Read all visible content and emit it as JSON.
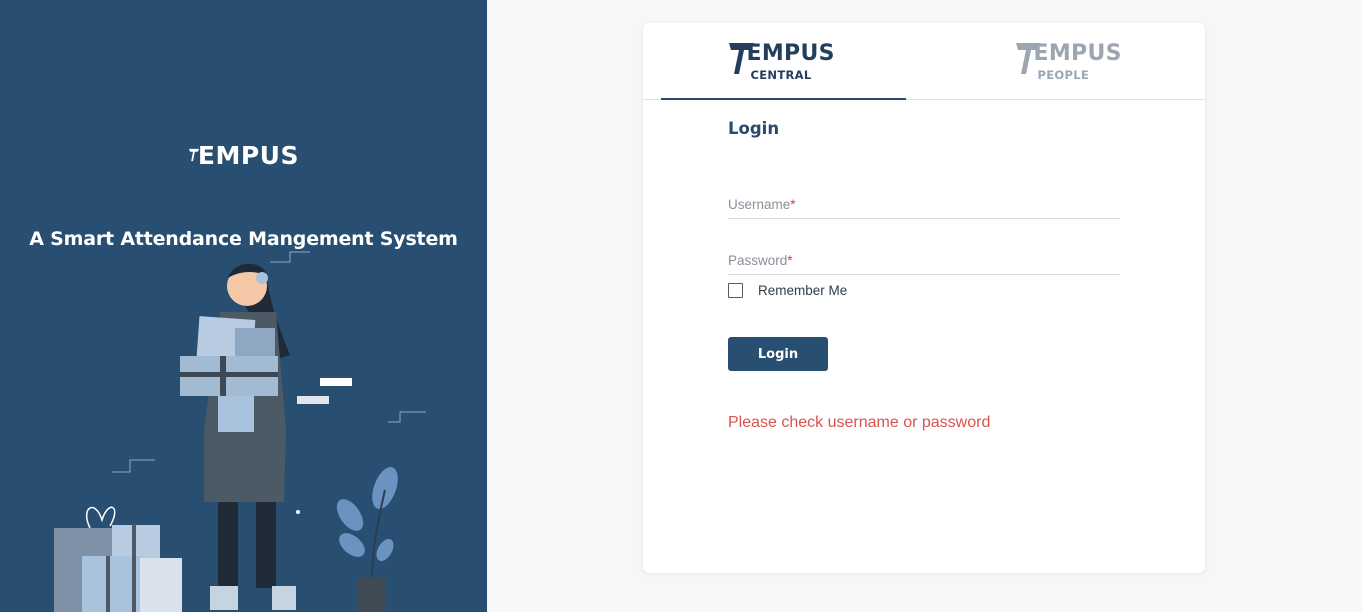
{
  "brand": {
    "logo_text": "EMPUS",
    "tagline": "A Smart Attendance Mangement System"
  },
  "tabs": [
    {
      "word": "EMPUS",
      "sub": "CENTRAL",
      "active": true,
      "color": "#243f5e"
    },
    {
      "word": "EMPUS",
      "sub": "PEOPLE",
      "active": false,
      "color": "#9ca6b2"
    }
  ],
  "form": {
    "title": "Login",
    "username_label": "Username",
    "password_label": "Password",
    "required_mark": "*",
    "remember_label": "Remember Me",
    "submit_label": "Login",
    "error": "Please check username or password"
  },
  "colors": {
    "brand_primary": "#284e71",
    "error": "#d9534f"
  }
}
